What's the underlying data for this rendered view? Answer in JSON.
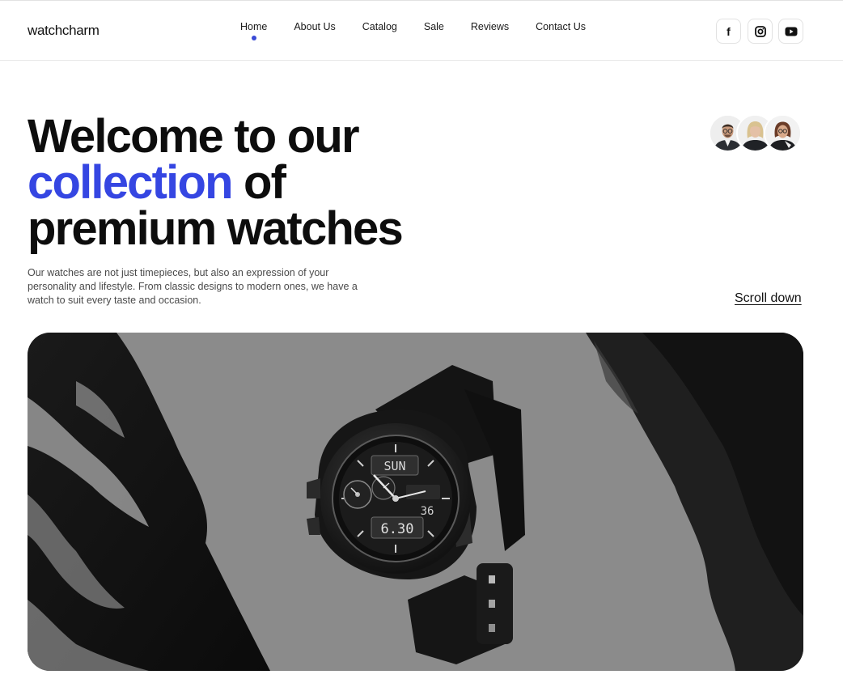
{
  "brand": {
    "logo_text": "watchcharm",
    "accent_color": "#3546e2"
  },
  "nav": {
    "items": [
      {
        "label": "Home",
        "active": true
      },
      {
        "label": "About Us",
        "active": false
      },
      {
        "label": "Catalog",
        "active": false
      },
      {
        "label": "Sale",
        "active": false
      },
      {
        "label": "Reviews",
        "active": false
      },
      {
        "label": "Contact Us",
        "active": false
      }
    ]
  },
  "social": [
    {
      "icon": "facebook-icon",
      "glyph": "f"
    },
    {
      "icon": "instagram-icon"
    },
    {
      "icon": "youtube-icon"
    }
  ],
  "hero": {
    "title_line1": "Welcome to our",
    "title_accent": "collection",
    "title_line2_rest": " of",
    "title_line3": "premium watches",
    "description": "Our watches are not just timepieces, but also an expression of your personality and lifestyle. From classic designs to modern ones, we have a watch to suit every taste and occasion.",
    "scroll_label": "Scroll down",
    "watch_display_top": "SUN",
    "watch_display_mid": "36",
    "watch_display_time": "6.30"
  },
  "avatars": [
    {
      "icon": "man-with-glasses-avatar"
    },
    {
      "icon": "blonde-woman-avatar"
    },
    {
      "icon": "woman-with-glasses-avatar"
    }
  ]
}
